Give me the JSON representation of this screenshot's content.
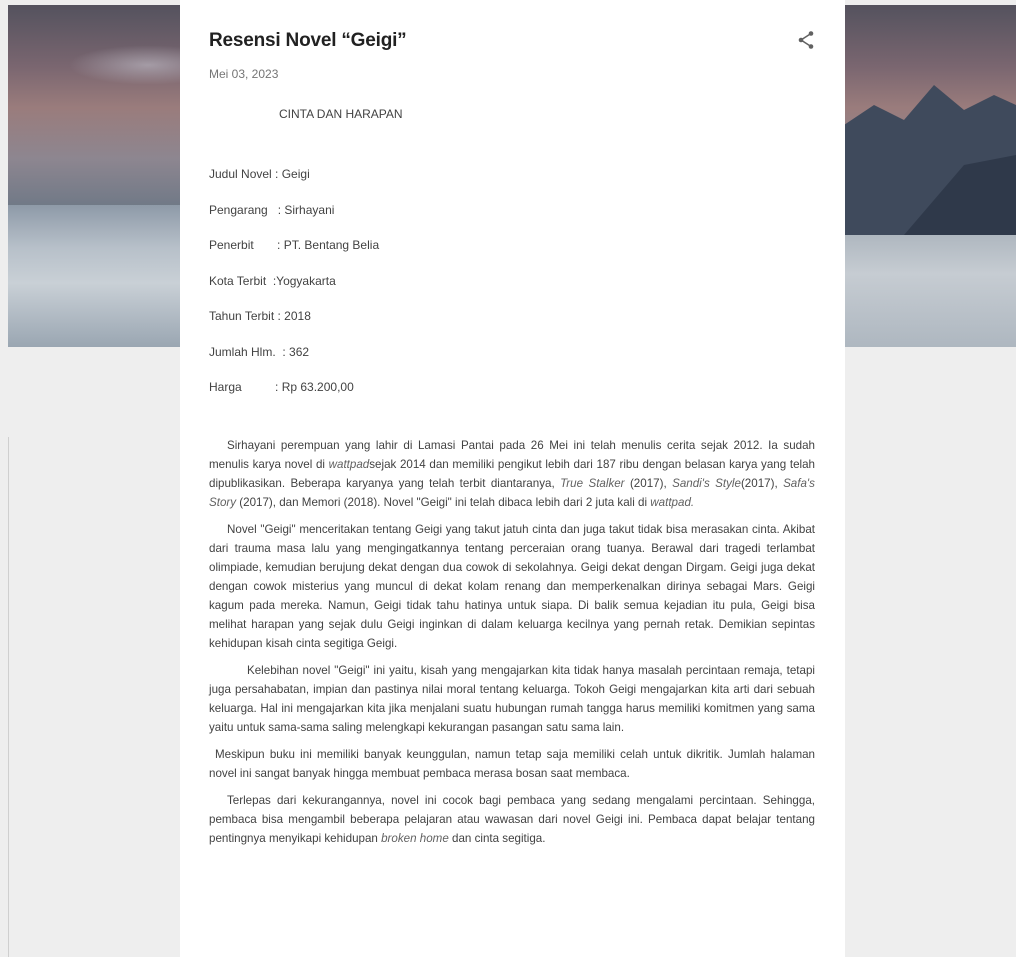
{
  "post": {
    "title": "Resensi Novel “Geigi”",
    "date": "Mei 03, 2023",
    "subheading": "CINTA DAN HARAPAN",
    "meta": [
      {
        "key": "Judul Novel ",
        "value": ": Geigi"
      },
      {
        "key": "Pengarang   ",
        "value": ": Sirhayani"
      },
      {
        "key": "Penerbit       ",
        "value": ": PT. Bentang Belia"
      },
      {
        "key": "Kota Terbit  ",
        "value": ":Yogyakarta"
      },
      {
        "key": "Tahun Terbit ",
        "value": ": 2018"
      },
      {
        "key": "Jumlah Hlm.  ",
        "value": ": 362"
      },
      {
        "key": "Harga          ",
        "value": ": Rp 63.200,00"
      }
    ],
    "p1": {
      "a": "Sirhayani perempuan yang lahir di Lamasi Pantai pada 26 Mei ini telah menulis cerita sejak 2012. Ia sudah menulis karya novel di ",
      "b": "wattpad",
      "c": "sejak 2014 dan memiliki pengikut lebih dari 187 ribu dengan belasan karya yang telah dipublikasikan. Beberapa karyanya yang telah terbit diantaranya, ",
      "d": "True Stalker",
      "e": " (2017), ",
      "f": "Sandi's Style",
      "g": "(2017), ",
      "h": "Safa's Story",
      "i": " (2017), dan Memori (2018). Novel \"Geigi\" ini telah dibaca lebih dari 2 juta kali di ",
      "j": "wattpad."
    },
    "p2": "Novel \"Geigi\" menceritakan tentang Geigi yang takut jatuh cinta dan juga takut tidak bisa merasakan cinta. Akibat dari trauma masa lalu yang mengingatkannya tentang perceraian orang tuanya. Berawal dari tragedi terlambat olimpiade, kemudian berujung dekat dengan dua cowok di sekolahnya. Geigi dekat dengan Dirgam. Geigi juga dekat dengan cowok misterius yang muncul di dekat kolam renang dan memperkenalkan dirinya sebagai Mars. Geigi kagum pada mereka. Namun, Geigi tidak tahu hatinya untuk siapa. Di balik semua kejadian itu pula, Geigi bisa melihat harapan yang sejak dulu Geigi inginkan di dalam keluarga kecilnya yang pernah retak. Demikian sepintas kehidupan kisah cinta segitiga Geigi.",
    "p3": "Kelebihan novel \"Geigi\" ini yaitu, kisah yang mengajarkan kita tidak hanya masalah percintaan remaja, tetapi juga persahabatan, impian dan pastinya nilai moral tentang keluarga.  Tokoh Geigi mengajarkan kita arti dari sebuah keluarga. Hal ini mengajarkan kita jika menjalani suatu hubungan rumah tangga harus memiliki komitmen yang sama yaitu untuk sama-sama saling melengkapi kekurangan pasangan satu sama lain.",
    "p4": "Meskipun buku ini memiliki banyak keunggulan, namun tetap saja memiliki celah untuk dikritik. Jumlah halaman novel ini sangat banyak hingga membuat pembaca merasa bosan saat membaca.",
    "p5": {
      "a": "Terlepas dari kekurangannya, novel ini  cocok bagi pembaca yang sedang mengalami percintaan. Sehingga, pembaca bisa mengambil beberapa pelajaran atau wawasan dari novel Geigi ini. Pembaca dapat belajar tentang pentingnya menyikapi kehidupan ",
      "b": "broken home",
      "c": " dan cinta segitiga."
    }
  },
  "icons": {
    "share": "share-icon"
  },
  "colors": {
    "background": "#eeeeee",
    "card": "#ffffff",
    "title": "#212121",
    "text": "#424242"
  }
}
